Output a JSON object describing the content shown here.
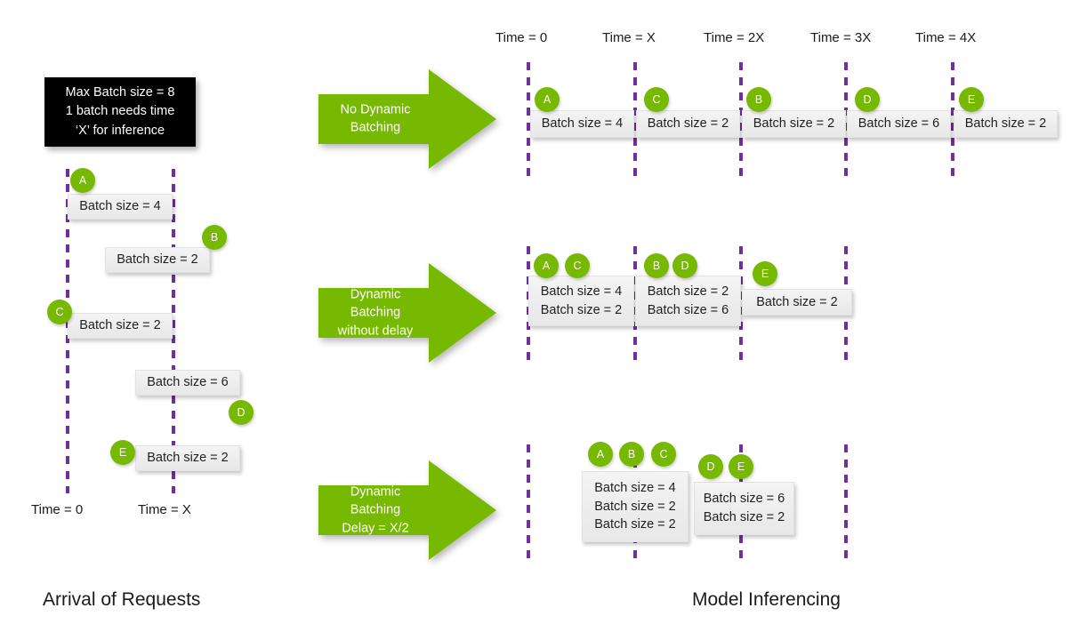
{
  "diagram": {
    "note": {
      "lines": [
        "Max Batch size = 8",
        "1 batch needs time",
        "‘X’ for inference"
      ]
    },
    "section_titles": {
      "left": "Arrival of Requests",
      "right": "Model Inferencing"
    },
    "colors": {
      "green": "#76b900",
      "purple": "#6f2f9f",
      "box_gray": "#ededed",
      "note_bg": "#000000"
    },
    "left_panel": {
      "time_labels": [
        {
          "text": "Time = 0"
        },
        {
          "text": "Time = X"
        }
      ],
      "requests": [
        {
          "id": "A",
          "label": "Batch size = 4"
        },
        {
          "id": "B",
          "label": "Batch size = 2"
        },
        {
          "id": "C",
          "label": "Batch size = 2"
        },
        {
          "id": "D",
          "label": "Batch size = 6"
        },
        {
          "id": "E",
          "label": "Batch size = 2"
        }
      ]
    },
    "right_panel": {
      "time_labels": [
        {
          "text": "Time = 0"
        },
        {
          "text": "Time = X"
        },
        {
          "text": "Time = 2X"
        },
        {
          "text": "Time = 3X"
        },
        {
          "text": "Time = 4X"
        }
      ],
      "rows": [
        {
          "arrow_label": "No Dynamic\nBatching",
          "arrow_lines": [
            "No Dynamic",
            "Batching"
          ],
          "slots": [
            {
              "badges": [
                "A"
              ],
              "lines": [
                "Batch size = 4"
              ]
            },
            {
              "badges": [
                "C"
              ],
              "lines": [
                "Batch size = 2"
              ]
            },
            {
              "badges": [
                "B"
              ],
              "lines": [
                "Batch size = 2"
              ]
            },
            {
              "badges": [
                "D"
              ],
              "lines": [
                "Batch size = 6"
              ]
            },
            {
              "badges": [
                "E"
              ],
              "lines": [
                "Batch size = 2"
              ]
            }
          ]
        },
        {
          "arrow_label": "Dynamic Batching\nwithout delay",
          "arrow_lines": [
            "Dynamic Batching",
            "without delay"
          ],
          "slots": [
            {
              "badges": [
                "A",
                "C"
              ],
              "lines": [
                "Batch size = 4",
                "Batch size = 2"
              ]
            },
            {
              "badges": [
                "B",
                "D"
              ],
              "lines": [
                "Batch size = 2",
                "Batch size = 6"
              ]
            },
            {
              "badges": [
                "E"
              ],
              "lines": [
                "Batch size = 2"
              ]
            }
          ]
        },
        {
          "arrow_label": "Dynamic Batching\nDelay = X/2",
          "arrow_lines": [
            "Dynamic Batching",
            "Delay = X/2"
          ],
          "slots": [
            {
              "badges": [
                "A",
                "B",
                "C"
              ],
              "lines": [
                "Batch size = 4",
                "Batch size = 2",
                "Batch size = 2"
              ]
            },
            {
              "badges": [
                "D",
                "E"
              ],
              "lines": [
                "Batch size = 6",
                "Batch size = 2"
              ]
            }
          ]
        }
      ]
    }
  }
}
